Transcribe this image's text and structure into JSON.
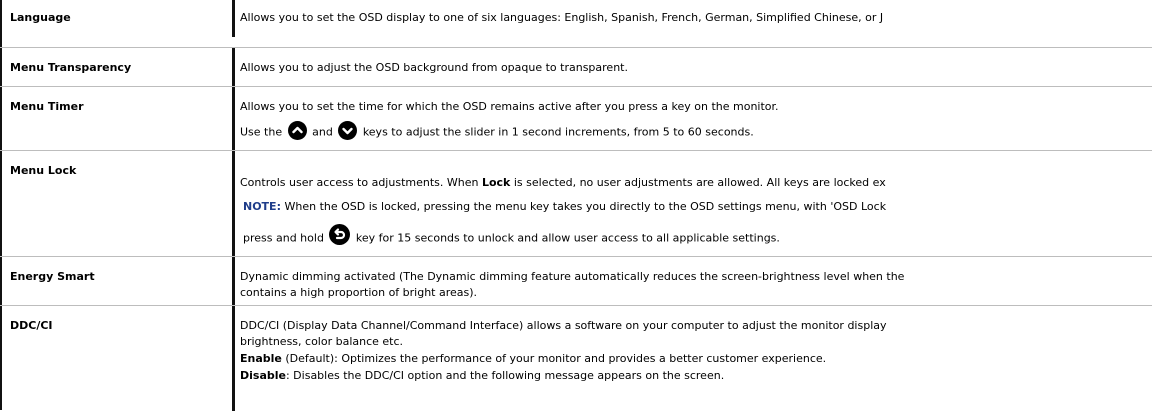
{
  "rows": [
    {
      "label": "Language",
      "lines": [
        "Allows you to set the OSD display to one of six languages: English, Spanish, French, German, Simplified Chinese, or J"
      ]
    },
    {
      "label": "Menu Transparency",
      "lines": [
        "Allows you to adjust the OSD background from opaque to transparent."
      ]
    },
    {
      "label": "Menu Timer",
      "line1": "Allows you to set the time for which the OSD remains active after you press a key on the monitor.",
      "line2_a": "Use the",
      "line2_b": "and",
      "line2_c": "keys to adjust the slider in 1 second increments, from 5 to 60 seconds."
    },
    {
      "label": "Menu Lock",
      "line1_a": "Controls user access to adjustments. When",
      "line1_b": "Lock",
      "line1_c": "is selected, no user adjustments are allowed. All keys are locked ex",
      "note_label": "NOTE:",
      "note_text": "When the OSD is locked, pressing the menu key takes you directly to the OSD settings menu, with 'OSD Lock",
      "line3_a": "press and hold",
      "line3_b": "key for 15 seconds to unlock and allow user access to all applicable settings."
    },
    {
      "label": "Energy Smart",
      "lines": [
        "Dynamic dimming activated (The Dynamic dimming feature automatically reduces the screen-brightness level when the",
        "contains a high proportion of bright areas)."
      ]
    },
    {
      "label": "DDC/CI",
      "line1": "DDC/CI (Display Data Channel/Command Interface) allows a software on your computer to adjust the monitor display",
      "line2": "brightness, color balance etc.",
      "enable_label": "Enable",
      "enable_text": "(Default): Optimizes the performance of your monitor and provides a better customer experience.",
      "disable_label": "Disable",
      "disable_text": ": Disables the DDC/CI option and the following message appears on the screen."
    }
  ],
  "icons": {
    "up": "chevron-up-icon",
    "down": "chevron-down-icon",
    "back": "back-arrow-icon"
  }
}
